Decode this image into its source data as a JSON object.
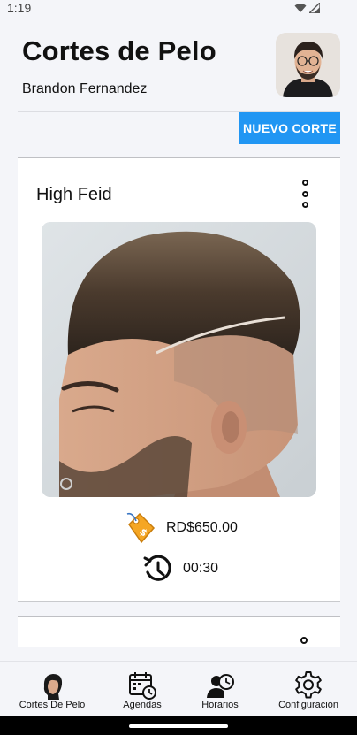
{
  "status_bar": {
    "time": "1:19"
  },
  "header": {
    "title": "Cortes de Pelo",
    "user_name": "Brandon Fernandez",
    "new_cut_label": "NUEVO CORTE"
  },
  "cards": [
    {
      "title": "High Feid",
      "price": "RD$650.00",
      "duration": "00:30"
    }
  ],
  "colors": {
    "accent": "#2196f3",
    "background": "#f4f5f9",
    "card": "#ffffff"
  },
  "bottom_nav": {
    "items": [
      {
        "label": "Cortes De Pelo",
        "icon": "haircut-head-icon"
      },
      {
        "label": "Agendas",
        "icon": "calendar-clock-icon"
      },
      {
        "label": "Horarios",
        "icon": "person-clock-icon"
      },
      {
        "label": "Configuración",
        "icon": "gear-icon"
      }
    ]
  }
}
